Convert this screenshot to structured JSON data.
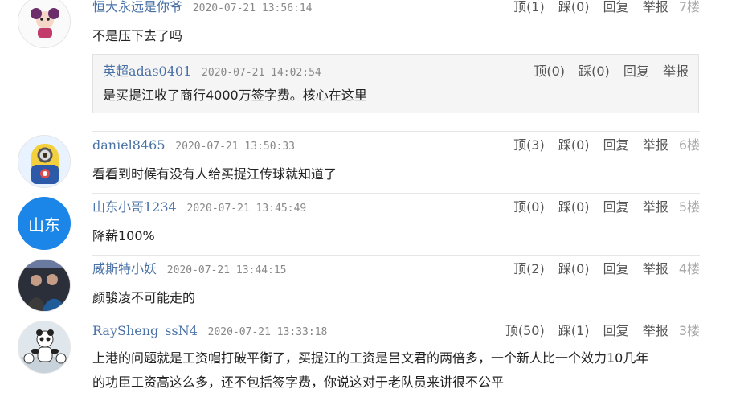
{
  "comments": [
    {
      "username": "恒大永远是你爷",
      "time": "2020-07-21 13:56:14",
      "up": "顶(1)",
      "down": "踩(0)",
      "reply": "回复",
      "report": "举报",
      "floor": "7楼",
      "text": "不是压下去了吗",
      "quote": {
        "username": "英超adas0401",
        "time": "2020-07-21 14:02:54",
        "up": "顶(0)",
        "down": "踩(0)",
        "reply": "回复",
        "report": "举报",
        "text": "是买提江收了商行4000万签字费。核心在这里"
      }
    },
    {
      "username": "daniel8465",
      "time": "2020-07-21 13:50:33",
      "up": "顶(3)",
      "down": "踩(0)",
      "reply": "回复",
      "report": "举报",
      "floor": "6楼",
      "text": "看看到时候有没有人给买提江传球就知道了"
    },
    {
      "username": "山东小哥1234",
      "time": "2020-07-21 13:45:49",
      "up": "顶(0)",
      "down": "踩(0)",
      "reply": "回复",
      "report": "举报",
      "floor": "5楼",
      "text": "降薪100%",
      "avatar_text": "山东"
    },
    {
      "username": "威斯特小妖",
      "time": "2020-07-21 13:44:15",
      "up": "顶(2)",
      "down": "踩(0)",
      "reply": "回复",
      "report": "举报",
      "floor": "4楼",
      "text": "颜骏凌不可能走的"
    },
    {
      "username": "RaySheng_ssN4",
      "time": "2020-07-21 13:33:18",
      "up": "顶(50)",
      "down": "踩(1)",
      "reply": "回复",
      "report": "举报",
      "floor": "3楼",
      "text_line1": "上港的问题就是工资帽打破平衡了，买提江的工资是吕文君的两倍多，一个新人比一个效力10几年",
      "text_line2": "的功臣工资高这么多，还不包括签字费，你说这对于老队员来讲很不公平"
    }
  ],
  "colors": {
    "username": "#4a72a6",
    "floor": "#aaaaaa",
    "shandong_avatar": "#1b86e8",
    "quote_bg": "#f5f5f5"
  }
}
